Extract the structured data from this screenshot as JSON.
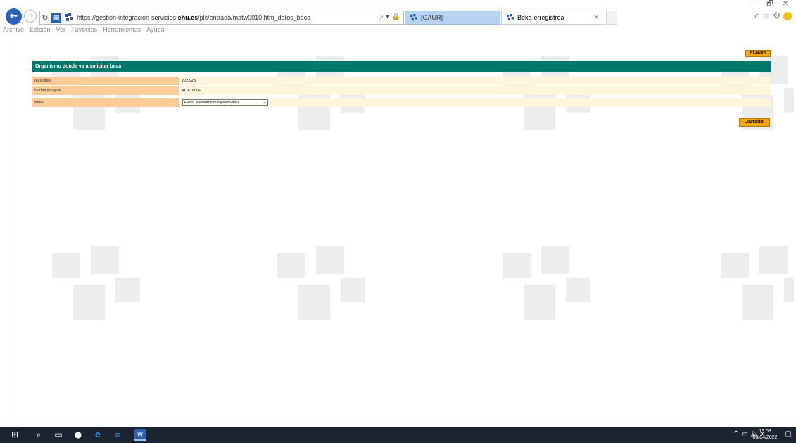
{
  "browser": {
    "url_prefix": "https://gestion-integracion-servicios.",
    "url_domain": "ehu.es",
    "url_suffix": "/pls/entrada/matw0010.htm_datos_beca",
    "address_tools": "⌕ ▾ 🔒",
    "tabs": [
      {
        "label": "[GAUR]"
      },
      {
        "label": "Beka-erregistroa",
        "close": "×"
      }
    ],
    "window_controls": {
      "minimize": "–",
      "restore": "🗗",
      "close": "✕"
    },
    "menu": [
      "Archivo",
      "Edición",
      "Ver",
      "Favoritos",
      "Herramientas",
      "Ayuda"
    ],
    "right_icons": [
      "⌂",
      "☆",
      "⚙"
    ]
  },
  "page": {
    "back_button": "ATZERA",
    "form_title": "Organismo donde va a solicitar beca",
    "rows": [
      {
        "label": "Ikasturtea",
        "value": "2022/23"
      },
      {
        "label": "Nortasun-agiria",
        "value": "41147800H"
      },
      {
        "label": "Beka",
        "value": "Eusko Jaurlaritzaren laguntza-beka"
      }
    ],
    "continue_button": "Jarraitu"
  },
  "taskbar": {
    "time": "13:08",
    "date": "08/04/2022",
    "tray": "^ ▭ 🔈×"
  },
  "colors": {
    "header_green": "#00796b",
    "label_orange": "#ffcc99",
    "value_cream": "#fff5dc",
    "button_orange": "#f5a50f",
    "browser_blue": "#2a63b6"
  }
}
